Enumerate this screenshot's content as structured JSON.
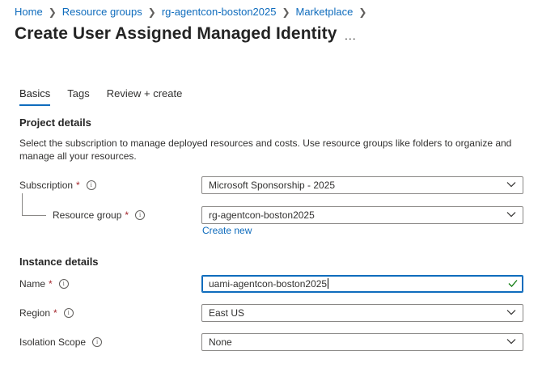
{
  "breadcrumb": [
    "Home",
    "Resource groups",
    "rg-agentcon-boston2025",
    "Marketplace"
  ],
  "page_title": "Create User Assigned Managed Identity",
  "more_label": "...",
  "tabs": [
    "Basics",
    "Tags",
    "Review + create"
  ],
  "project_details": {
    "heading": "Project details",
    "description": "Select the subscription to manage deployed resources and costs. Use resource groups like folders to organize and manage all your resources."
  },
  "subscription": {
    "label": "Subscription",
    "required": "*",
    "value": "Microsoft Sponsorship - 2025"
  },
  "resource_group": {
    "label": "Resource group",
    "required": "*",
    "value": "rg-agentcon-boston2025",
    "create_new": "Create new"
  },
  "instance_details": {
    "heading": "Instance details"
  },
  "name": {
    "label": "Name",
    "required": "*",
    "value": "uami-agentcon-boston2025"
  },
  "region": {
    "label": "Region",
    "required": "*",
    "value": "East US"
  },
  "isolation_scope": {
    "label": "Isolation Scope",
    "value": "None"
  },
  "colors": {
    "accent": "#0f6cbd",
    "required": "#a4262c",
    "valid": "#107c10"
  }
}
